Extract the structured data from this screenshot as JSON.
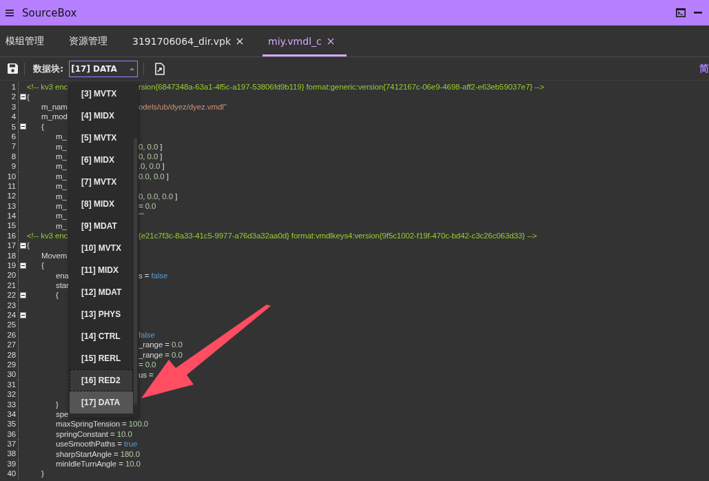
{
  "window": {
    "title": "SourceBox"
  },
  "tabs": [
    {
      "label": "模组管理",
      "closable": false,
      "selected": false
    },
    {
      "label": "资源管理",
      "closable": false,
      "selected": false
    },
    {
      "label": "3191706064_dir.vpk",
      "closable": true,
      "selected": false
    },
    {
      "label": "miy.vmdl_c",
      "closable": true,
      "selected": true
    }
  ],
  "toolbar": {
    "block_label": "数据块:",
    "block_value": "[17] DATA",
    "right_text": "简"
  },
  "dropdown": [
    {
      "label": "[3] MVTX",
      "selected": false,
      "focused": false
    },
    {
      "label": "[4] MIDX",
      "selected": false,
      "focused": false
    },
    {
      "label": "[5] MVTX",
      "selected": false,
      "focused": false
    },
    {
      "label": "[6] MIDX",
      "selected": false,
      "focused": false
    },
    {
      "label": "[7] MVTX",
      "selected": false,
      "focused": false
    },
    {
      "label": "[8] MIDX",
      "selected": false,
      "focused": false
    },
    {
      "label": "[9] MDAT",
      "selected": false,
      "focused": false
    },
    {
      "label": "[10] MVTX",
      "selected": false,
      "focused": false
    },
    {
      "label": "[11] MIDX",
      "selected": false,
      "focused": false
    },
    {
      "label": "[12] MDAT",
      "selected": false,
      "focused": false
    },
    {
      "label": "[13] PHYS",
      "selected": false,
      "focused": false
    },
    {
      "label": "[14] CTRL",
      "selected": false,
      "focused": false
    },
    {
      "label": "[15] RERL",
      "selected": false,
      "focused": false
    },
    {
      "label": "[16] RED2",
      "selected": false,
      "focused": true
    },
    {
      "label": "[17] DATA",
      "selected": true,
      "focused": false
    }
  ],
  "editor": {
    "lines": [
      {
        "number": "1",
        "fold": false,
        "left": [
          {
            "text": "<!-- kv3 enc",
            "kind": "comment"
          }
        ],
        "right": [
          {
            "text": "rsion{6847348a-63a1-4f5c-a197-53806fd9b119} format:generic:version{7412167c-06e9-4698-aff2-e63eb59037e7} -->",
            "kind": "comment"
          }
        ]
      },
      {
        "number": "2",
        "fold": true,
        "left": [
          {
            "text": "{",
            "kind": "plain"
          }
        ],
        "children": [
          {
            "number": "3",
            "fold": false,
            "left": [
              {
                "text": "m_nam",
                "kind": "plain"
              }
            ],
            "right": [
              {
                "text": "odels/ub/dyez/dyez.vmdl\"",
                "kind": "string"
              }
            ]
          },
          {
            "number": "4",
            "fold": false,
            "left": [
              {
                "text": "m_mod",
                "kind": "plain"
              }
            ]
          },
          {
            "number": "5",
            "fold": true,
            "left": [
              {
                "text": "{",
                "kind": "plain"
              }
            ],
            "children": [
              {
                "number": "6",
                "fold": false,
                "left": [
                  {
                    "text": "m_",
                    "kind": "plain"
                  }
                ]
              },
              {
                "number": "7",
                "fold": false,
                "left": [
                  {
                    "text": "m_",
                    "kind": "plain"
                  }
                ],
                "right": [
                  {
                    "text": "0, 0.0",
                    "kind": "number"
                  },
                  {
                    "text": " ]",
                    "kind": "plain"
                  }
                ]
              },
              {
                "number": "8",
                "fold": false,
                "left": [
                  {
                    "text": "m_",
                    "kind": "plain"
                  }
                ],
                "right": [
                  {
                    "text": "0, 0.0",
                    "kind": "number"
                  },
                  {
                    "text": " ]",
                    "kind": "plain"
                  }
                ]
              },
              {
                "number": "9",
                "fold": false,
                "left": [
                  {
                    "text": "m_",
                    "kind": "plain"
                  }
                ],
                "right": [
                  {
                    "text": ".0, 0.0",
                    "kind": "number"
                  },
                  {
                    "text": " ]",
                    "kind": "plain"
                  }
                ]
              },
              {
                "number": "10",
                "fold": false,
                "left": [
                  {
                    "text": "m_",
                    "kind": "plain"
                  }
                ],
                "right": [
                  {
                    "text": "0.0, 0.0",
                    "kind": "number"
                  },
                  {
                    "text": " ]",
                    "kind": "plain"
                  }
                ]
              },
              {
                "number": "11",
                "fold": false,
                "left": [
                  {
                    "text": "m_",
                    "kind": "plain"
                  }
                ]
              },
              {
                "number": "12",
                "fold": false,
                "left": [
                  {
                    "text": "m_",
                    "kind": "plain"
                  }
                ],
                "right": [
                  {
                    "text": "0, 0.0, 0.0",
                    "kind": "number"
                  },
                  {
                    "text": " ]",
                    "kind": "plain"
                  }
                ]
              },
              {
                "number": "13",
                "fold": false,
                "left": [
                  {
                    "text": "m_",
                    "kind": "plain"
                  }
                ],
                "right": [
                  {
                    "text": "= ",
                    "kind": "plain"
                  },
                  {
                    "text": "0.0",
                    "kind": "number"
                  }
                ]
              },
              {
                "number": "14",
                "fold": false,
                "left": [
                  {
                    "text": "m_",
                    "kind": "plain"
                  }
                ],
                "right": [
                  {
                    "text": "\"\"",
                    "kind": "string"
                  }
                ]
              },
              {
                "number": "15",
                "fold": false,
                "left": [
                  {
                    "text": "m_",
                    "kind": "plain"
                  }
                ]
              }
            ]
          }
        ]
      },
      {
        "number": "16",
        "fold": false,
        "left": [
          {
            "text": "<!-- kv3 enc",
            "kind": "comment"
          }
        ],
        "right": [
          {
            "text": "{e21c7f3c-8a33-41c5-9977-a76d3a32aa0d} format:vmdlkeys4:version{9f5c1002-f19f-470c-bd42-c3c26c063d33} -->",
            "kind": "comment"
          }
        ]
      },
      {
        "number": "17",
        "fold": true,
        "left": [
          {
            "text": "{",
            "kind": "plain"
          }
        ],
        "children": [
          {
            "number": "18",
            "fold": false,
            "left": [
              {
                "text": "Movem",
                "kind": "plain"
              }
            ]
          },
          {
            "number": "19",
            "fold": true,
            "left": [
              {
                "text": "{",
                "kind": "plain"
              }
            ],
            "children": [
              {
                "number": "20",
                "fold": false,
                "left": [
                  {
                    "text": "ena",
                    "kind": "plain"
                  }
                ],
                "right": [
                  {
                    "text": "s = ",
                    "kind": "plain"
                  },
                  {
                    "text": "false",
                    "kind": "keyword"
                  }
                ]
              },
              {
                "number": "21",
                "fold": false,
                "left": [
                  {
                    "text": "star",
                    "kind": "plain"
                  }
                ]
              },
              {
                "number": "22",
                "fold": true,
                "left": [
                  {
                    "text": "{",
                    "kind": "plain"
                  }
                ]
              },
              {
                "number": "23",
                "fold": false
              },
              {
                "number": "24",
                "fold": true
              },
              {
                "number": "25",
                "fold": false
              },
              {
                "number": "26",
                "fold": false,
                "right": [
                  {
                    "text": "false",
                    "kind": "keyword"
                  }
                ]
              },
              {
                "number": "27",
                "fold": false,
                "right": [
                  {
                    "text": "_range = ",
                    "kind": "plain"
                  },
                  {
                    "text": "0.0",
                    "kind": "number"
                  }
                ]
              },
              {
                "number": "28",
                "fold": false,
                "right": [
                  {
                    "text": "_range = ",
                    "kind": "plain"
                  },
                  {
                    "text": "0.0",
                    "kind": "number"
                  }
                ]
              },
              {
                "number": "29",
                "fold": false,
                "right": [
                  {
                    "text": "= ",
                    "kind": "plain"
                  },
                  {
                    "text": "0.0",
                    "kind": "number"
                  }
                ]
              },
              {
                "number": "30",
                "fold": false,
                "right": [
                  {
                    "text": "us =",
                    "kind": "plain"
                  }
                ]
              },
              {
                "number": "31",
                "fold": false
              },
              {
                "number": "32",
                "fold": false
              },
              {
                "number": "33",
                "fold": false,
                "left": [
                  {
                    "text": "}",
                    "kind": "plain"
                  }
                ]
              },
              {
                "number": "34",
                "fold": false,
                "left": [
                  {
                    "text": "spe",
                    "kind": "plain"
                  }
                ]
              },
              {
                "number": "35",
                "fold": false,
                "left": [
                  {
                    "text": "maxSpringTension = ",
                    "kind": "plain"
                  },
                  {
                    "text": "100.0",
                    "kind": "number"
                  }
                ]
              },
              {
                "number": "36",
                "fold": false,
                "left": [
                  {
                    "text": "springConstant = ",
                    "kind": "plain"
                  },
                  {
                    "text": "10.0",
                    "kind": "number"
                  }
                ]
              },
              {
                "number": "37",
                "fold": false,
                "left": [
                  {
                    "text": "useSmoothPaths = ",
                    "kind": "plain"
                  },
                  {
                    "text": "true",
                    "kind": "keyword"
                  }
                ]
              },
              {
                "number": "38",
                "fold": false,
                "left": [
                  {
                    "text": "sharpStartAngle = ",
                    "kind": "plain"
                  },
                  {
                    "text": "180.0",
                    "kind": "number"
                  }
                ]
              },
              {
                "number": "39",
                "fold": false,
                "left": [
                  {
                    "text": "minIdleTurnAngle = ",
                    "kind": "plain"
                  },
                  {
                    "text": "10.0",
                    "kind": "number"
                  }
                ]
              }
            ]
          },
          {
            "number": "40",
            "fold": false,
            "left": [
              {
                "text": "}",
                "kind": "plain"
              }
            ]
          }
        ]
      }
    ]
  }
}
